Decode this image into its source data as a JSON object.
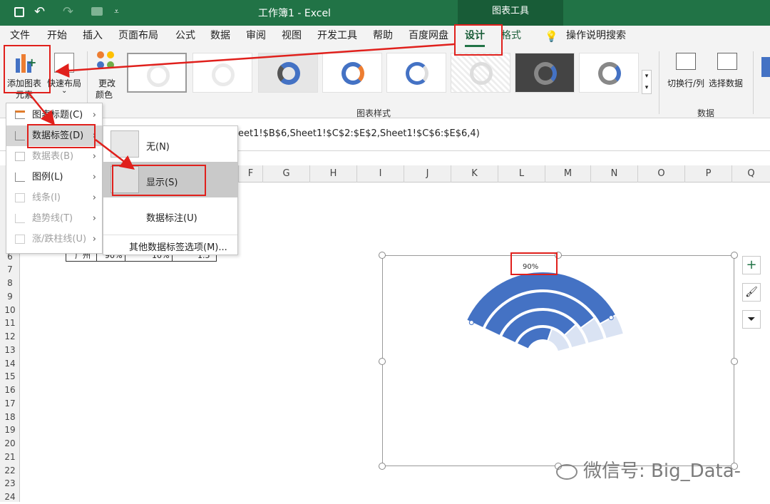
{
  "titlebar": {
    "title": "工作簿1 - Excel",
    "chart_tools": "图表工具"
  },
  "tabs": [
    "文件",
    "开始",
    "插入",
    "页面布局",
    "公式",
    "数据",
    "审阅",
    "视图",
    "开发工具",
    "帮助",
    "百度网盘",
    "设计",
    "格式"
  ],
  "tell_me": "操作说明搜索",
  "ribbon": {
    "add_chart_element_line1": "添加图表",
    "add_chart_element_line2": "元素",
    "quick_layout": "快速布局",
    "change_colors_line1": "更改",
    "change_colors_line2": "颜色",
    "chart_styles_group": "图表样式",
    "switch_row_col": "切换行/列",
    "select_data": "选择数据",
    "data_group": "数据"
  },
  "formula": {
    "text": "eet1!$B$6,Sheet1!$C$2:$E$2,Sheet1!$C$6:$E$6,4)"
  },
  "columns": [
    "F",
    "G",
    "H",
    "I",
    "J",
    "K",
    "L",
    "M",
    "N",
    "O",
    "P",
    "Q"
  ],
  "rows": [
    "6",
    "7",
    "8",
    "9",
    "10",
    "11",
    "12",
    "13",
    "14",
    "15",
    "16",
    "17",
    "18",
    "19",
    "20",
    "21",
    "22",
    "23",
    "24"
  ],
  "cells": {
    "row6_a": "广州",
    "row6_b": "90%",
    "row6_c": "10%",
    "row6_d": "1.5"
  },
  "menu1": {
    "items": [
      "图表标题(C)",
      "数据标签(D)",
      "数据表(B)",
      "图例(L)",
      "线条(I)",
      "趋势线(T)",
      "涨/跌柱线(U)"
    ]
  },
  "menu2": {
    "none": "无(N)",
    "show": "显示(S)",
    "callout": "数据标注(U)",
    "more": "其他数据标签选项(M)..."
  },
  "chart": {
    "data_label": "90%"
  },
  "chart_data": {
    "type": "pie",
    "series": [
      {
        "values": [
          90,
          10
        ]
      },
      {
        "values": [
          85,
          15
        ]
      },
      {
        "values": [
          80,
          20
        ]
      },
      {
        "values": [
          60,
          40
        ]
      }
    ],
    "data_labels": [
      "90%"
    ]
  },
  "watermark": "微信号: Big_Data-",
  "colors": {
    "excel_green": "#217346",
    "series_blue": "#4472c4",
    "series_light": "#dae3f3",
    "highlight_red": "#e0201c"
  }
}
